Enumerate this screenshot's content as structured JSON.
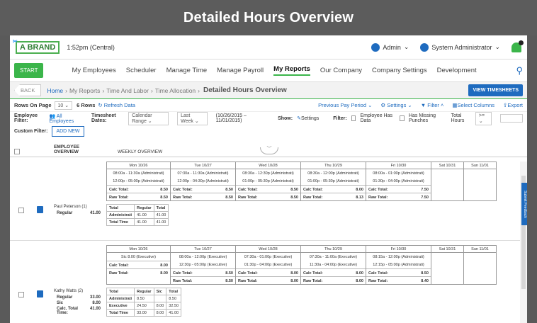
{
  "banner": "Detailed Hours Overview",
  "brand": "A BRAND",
  "time": "1:52pm (Central)",
  "admin": "Admin",
  "role": "System Administrator",
  "start": "START",
  "nav": [
    "My Employees",
    "Scheduler",
    "Manage Time",
    "Manage Payroll",
    "My Reports",
    "Our Company",
    "Company Settings",
    "Development"
  ],
  "back": "BACK",
  "crumbs": [
    "Home",
    "My Reports",
    "Time And Labor",
    "Time Allocation"
  ],
  "page_title": "Detailed Hours Overview",
  "view_ts": "VIEW TIMESHEETS",
  "rows_on_page_label": "Rows On Page",
  "rows_on_page": "10",
  "rows_count": "6 Rows",
  "refresh": "Refresh Data",
  "prev_period": "Previous Pay Period",
  "settings": "Settings",
  "filter": "Filter",
  "select_columns": "Select Columns",
  "export": "Export",
  "emp_filter_label": "Employee Filter:",
  "emp_filter": "All Employees",
  "ts_dates_label": "Timesheet Dates:",
  "calendar_range": "Calendar Range",
  "last_week": "Last Week",
  "date_range": "(10/26/2015 – 11/01/2015)",
  "show_label": "Show:",
  "show_settings": "Settings",
  "filter_label": "Filter:",
  "emp_has_data": "Employee Has Data",
  "has_missing": "Has Missing Punches",
  "total_hours": "Total Hours",
  "op": ">=",
  "custom_filter": "Custom Filter:",
  "add_new": "ADD NEW",
  "col_emp": "EMPLOYEE OVERVIEW",
  "col_week": "WEEKLY OVERVIEW",
  "submit_feedback": "Submit Feedback",
  "employees": [
    {
      "name": "Paul Peterson (1)",
      "lines": [
        {
          "k": "Regular",
          "v": "41.00"
        }
      ],
      "days": [
        {
          "h": "Mon 10/26",
          "punches": [
            "08:00a - 11:30a (Administrati)",
            "12:00p - 05:00p (Administrati)"
          ],
          "calc": "8.50",
          "raw": "8.50"
        },
        {
          "h": "Tue 10/27",
          "punches": [
            "07:30a - 11:30a (Administrati)",
            "12:00p - 04:30p (Administrati)"
          ],
          "calc": "8.50",
          "raw": "8.50"
        },
        {
          "h": "Wed 10/28",
          "punches": [
            "08:30a - 12:30p (Administrati)",
            "01:00p - 05:30p (Administrati)"
          ],
          "calc": "8.50",
          "raw": "8.50"
        },
        {
          "h": "Thu 10/29",
          "punches": [
            "08:30a - 12:00p (Administrati)",
            "01:00p - 05:30p (Administrati)"
          ],
          "calc": "8.00",
          "raw": "8.13"
        },
        {
          "h": "Fri 10/30",
          "punches": [
            "08:00a - 01:00p (Administrati)",
            "01:30p - 04:00p (Administrati)"
          ],
          "calc": "7.50",
          "raw": "7.50"
        },
        {
          "h": "Sat 10/31",
          "punches": [],
          "calc": "",
          "raw": ""
        },
        {
          "h": "Sun 11/01",
          "punches": [],
          "calc": "",
          "raw": ""
        }
      ],
      "summary": {
        "head": [
          "Total",
          "Regular",
          "Total"
        ],
        "rows": [
          [
            "Administrati",
            "41.00",
            "41.00"
          ],
          [
            "Total Time",
            "41.00",
            "41.00"
          ]
        ]
      }
    },
    {
      "name": "Kathy Watts (2)",
      "lines": [
        {
          "k": "Regular",
          "v": "33.00"
        },
        {
          "k": "Sic",
          "v": "8.00"
        },
        {
          "k": "Calc. Total Time:",
          "v": "41.00"
        }
      ],
      "days": [
        {
          "h": "Mon 10/26",
          "punches": [
            "Sic   8.00 (Executive)"
          ],
          "calc": "8.00",
          "raw": "8.00"
        },
        {
          "h": "Tue 10/27",
          "punches": [
            "08:00a - 12:00p (Executive)",
            "12:30p - 05:00p (Executive)"
          ],
          "calc": "8.50",
          "raw": "8.50"
        },
        {
          "h": "Wed 10/28",
          "punches": [
            "07:30a - 01:00p (Executive)",
            "01:30p - 04:00p (Executive)"
          ],
          "calc": "8.00",
          "raw": "8.00"
        },
        {
          "h": "Thu 10/29",
          "punches": [
            "07:30a - 11:00a (Executive)",
            "11:30a - 04:00p (Executive)"
          ],
          "calc": "8.00",
          "raw": "8.00"
        },
        {
          "h": "Fri 10/30",
          "punches": [
            "08:15a - 12:00p (Administrati)",
            "12:15p - 05:00p (Administrati)"
          ],
          "calc": "8.50",
          "raw": "8.40"
        },
        {
          "h": "Sat 10/31",
          "punches": [],
          "calc": "",
          "raw": ""
        },
        {
          "h": "Sun 11/01",
          "punches": [],
          "calc": "",
          "raw": ""
        }
      ],
      "summary": {
        "head": [
          "Total",
          "Regular",
          "Sic",
          "Total"
        ],
        "rows": [
          [
            "Administrati",
            "8.50",
            "",
            "8.50"
          ],
          [
            "Executive",
            "24.50",
            "8.00",
            "32.50"
          ],
          [
            "Total Time",
            "33.00",
            "8.00",
            "41.00"
          ]
        ]
      }
    }
  ],
  "labels": {
    "calc": "Calc Total:",
    "raw": "Raw Total:"
  }
}
